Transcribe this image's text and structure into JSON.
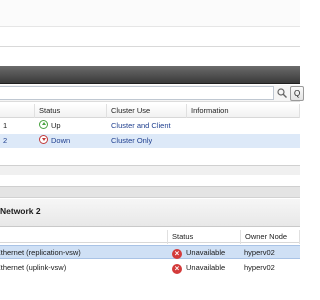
{
  "search": {
    "value": "",
    "placeholder": "",
    "go_label": "Q"
  },
  "networks_grid": {
    "columns": [
      "Status",
      "Cluster Use",
      "Information"
    ],
    "rows": [
      {
        "id": "1",
        "status": "Up",
        "cluster_use": "Cluster and Client",
        "information": ""
      },
      {
        "id": "2",
        "status": "Down",
        "cluster_use": "Cluster Only",
        "information": ""
      }
    ]
  },
  "detail": {
    "title": "Network 2",
    "columns": [
      "Status",
      "Owner Node"
    ],
    "rows": [
      {
        "name": "vEthernet (replication-vsw)",
        "status": "Unavailable",
        "owner": "hyperv02"
      },
      {
        "name": "vEthernet (uplink-vsw)",
        "status": "Unavailable",
        "owner": "hyperv02"
      }
    ]
  },
  "colors": {
    "selection": "#dde9f8",
    "up": "#4aa341",
    "down": "#c23b3b",
    "dark_bar": "#4a4a4a"
  }
}
